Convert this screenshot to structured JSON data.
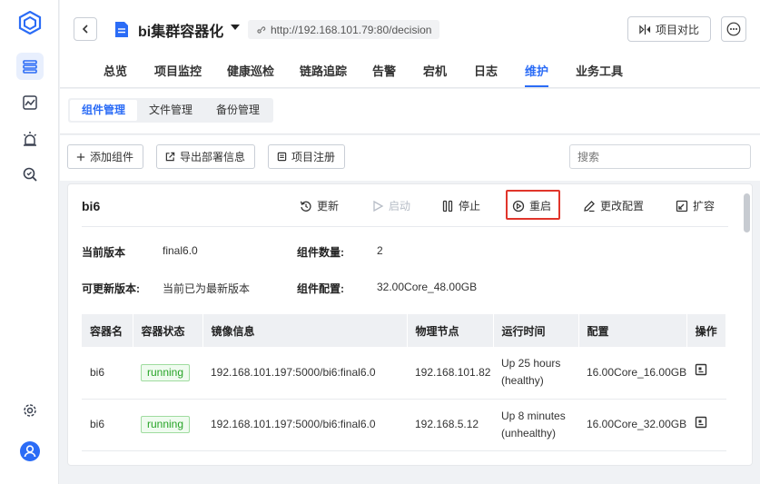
{
  "header": {
    "project_title": "bi集群容器化",
    "url": "http://192.168.101.79:80/decision",
    "compare_label": "项目对比"
  },
  "nav": {
    "tabs": [
      {
        "label": "总览"
      },
      {
        "label": "项目监控"
      },
      {
        "label": "健康巡检"
      },
      {
        "label": "链路追踪"
      },
      {
        "label": "告警"
      },
      {
        "label": "宕机"
      },
      {
        "label": "日志"
      },
      {
        "label": "维护"
      },
      {
        "label": "业务工具"
      }
    ],
    "active": "维护"
  },
  "subnav": {
    "tabs": [
      {
        "label": "组件管理"
      },
      {
        "label": "文件管理"
      },
      {
        "label": "备份管理"
      }
    ]
  },
  "toolbar": {
    "add_label": "添加组件",
    "export_label": "导出部署信息",
    "register_label": "项目注册",
    "search_placeholder": "搜索"
  },
  "card": {
    "title": "bi6",
    "actions": {
      "update": "更新",
      "start": "启动",
      "stop": "停止",
      "restart": "重启",
      "config": "更改配置",
      "scale": "扩容"
    },
    "info": {
      "current_version_label": "当前版本",
      "current_version": "final6.0",
      "component_count_label": "组件数量:",
      "component_count": "2",
      "updatable_label": "可更新版本:",
      "updatable_value": "当前已为最新版本",
      "component_config_label": "组件配置:",
      "component_config": "32.00Core_48.00GB"
    },
    "table": {
      "columns": [
        "容器名",
        "容器状态",
        "镜像信息",
        "物理节点",
        "运行时间",
        "配置",
        "操作"
      ],
      "rows": [
        {
          "name": "bi6",
          "status": "running",
          "image": "192.168.101.197:5000/bi6:final6.0",
          "node": "192.168.101.82",
          "uptime": "Up 25 hours",
          "health": "(healthy)",
          "config": "16.00Core_16.00GB"
        },
        {
          "name": "bi6",
          "status": "running",
          "image": "192.168.101.197:5000/bi6:final6.0",
          "node": "192.168.5.12",
          "uptime": "Up 8 minutes",
          "health": "(unhealthy)",
          "config": "16.00Core_32.00GB"
        }
      ]
    }
  },
  "colors": {
    "accent": "#2b6cf6",
    "running_green": "#27a427",
    "highlight_red": "#e0352b"
  }
}
